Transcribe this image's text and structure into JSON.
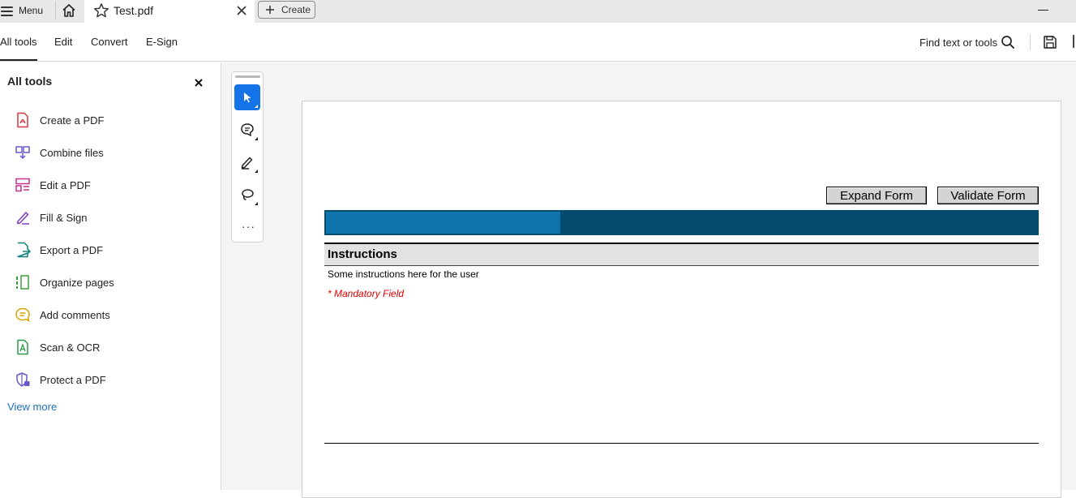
{
  "titlebar": {
    "menu_label": "Menu",
    "tab_title": "Test.pdf",
    "create_label": "Create"
  },
  "toolbar": {
    "tabs": [
      {
        "label": "All tools",
        "active": true
      },
      {
        "label": "Edit",
        "active": false
      },
      {
        "label": "Convert",
        "active": false
      },
      {
        "label": "E-Sign",
        "active": false
      }
    ],
    "find_label": "Find text or tools"
  },
  "sidebar": {
    "title": "All tools",
    "items": [
      {
        "label": "Create a PDF",
        "icon": "create-pdf-icon",
        "color": "#d7373f"
      },
      {
        "label": "Combine files",
        "icon": "combine-files-icon",
        "color": "#6a5acd"
      },
      {
        "label": "Edit a PDF",
        "icon": "edit-pdf-icon",
        "color": "#c7318d"
      },
      {
        "label": "Fill & Sign",
        "icon": "fill-sign-icon",
        "color": "#7e3fc8"
      },
      {
        "label": "Export a PDF",
        "icon": "export-pdf-icon",
        "color": "#11807a"
      },
      {
        "label": "Organize pages",
        "icon": "organize-pages-icon",
        "color": "#3f9f3b"
      },
      {
        "label": "Add comments",
        "icon": "add-comments-icon",
        "color": "#d8a200"
      },
      {
        "label": "Scan & OCR",
        "icon": "scan-ocr-icon",
        "color": "#2e9a48"
      },
      {
        "label": "Protect a PDF",
        "icon": "protect-pdf-icon",
        "color": "#6758c9"
      }
    ],
    "view_more": "View more"
  },
  "vertical_tools": [
    {
      "name": "select-tool",
      "icon": "cursor-icon",
      "active": true
    },
    {
      "name": "comment-tool",
      "icon": "comment-icon",
      "active": false
    },
    {
      "name": "draw-tool",
      "icon": "pen-icon",
      "active": false
    },
    {
      "name": "freehand-tool",
      "icon": "lasso-icon",
      "active": false
    }
  ],
  "document": {
    "expand_button": "Expand Form",
    "validate_button": "Validate Form",
    "banner_progress_fraction": 0.33,
    "instructions_heading": "Instructions",
    "instructions_text": "Some instructions here for the user",
    "mandatory_note": "* Mandatory Field"
  },
  "colors": {
    "accent": "#1473e6",
    "banner_dark": "#044c6e",
    "banner_light": "#0f74ad",
    "mandatory_red": "#e00000",
    "link_blue": "#1f6fbf"
  }
}
